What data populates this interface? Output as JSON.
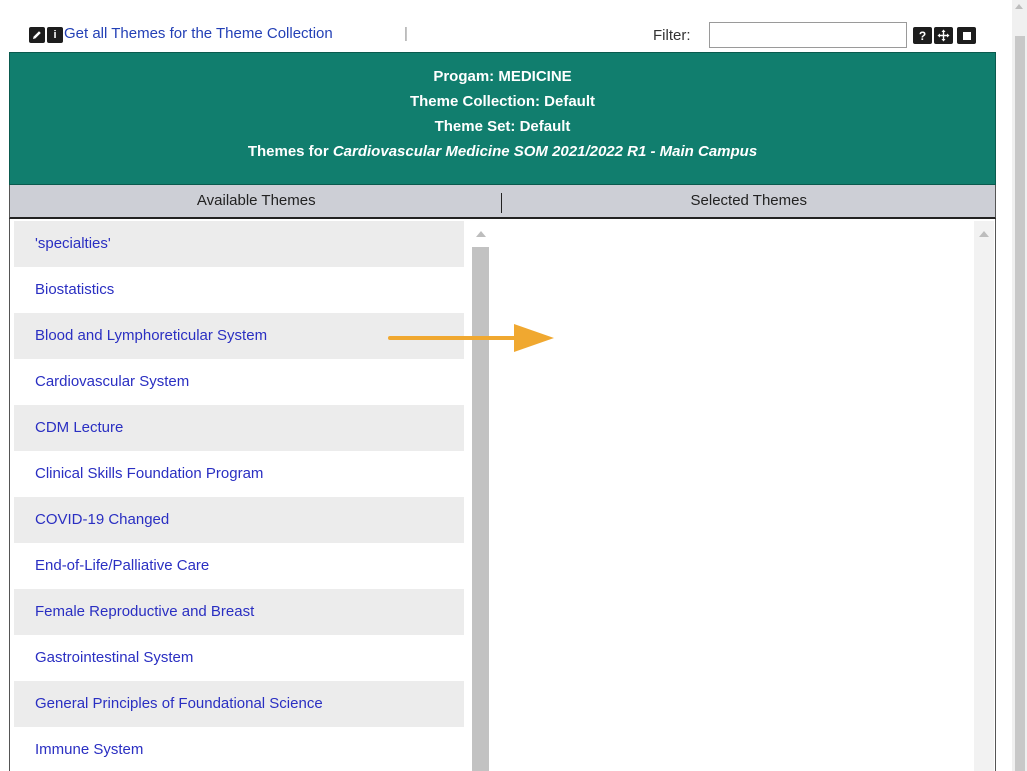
{
  "toolbar": {
    "edit_icon": "pencil-icon",
    "info_icon": "info-icon",
    "info_glyph": "i",
    "link": "Get all Themes for the Theme Collection",
    "separator": "|",
    "filter_label": "Filter:",
    "filter_value": "",
    "help_glyph": "?",
    "help_icon": "help-icon",
    "move_icon": "move-icon",
    "stop_icon": "square-icon"
  },
  "header": {
    "program": "Progam: MEDICINE",
    "collection": "Theme Collection: Default",
    "set": "Theme Set: Default",
    "themes_for_prefix": "Themes for",
    "course": "Cardiovascular Medicine SOM 2021/2022 R1 - Main Campus",
    "color": "#117e6e"
  },
  "columns": {
    "available": "Available Themes",
    "selected": "Selected Themes"
  },
  "available_themes": [
    "'specialties'",
    "Biostatistics",
    "Blood and Lymphoreticular System",
    "Cardiovascular System",
    "CDM Lecture",
    "Clinical Skills Foundation Program",
    "COVID-19 Changed",
    "End-of-Life/Palliative Care",
    "Female Reproductive and Breast",
    "Gastrointestinal System",
    "General Principles of Foundational Science",
    "Immune System"
  ],
  "selected_themes": [],
  "annotation": {
    "arrow_color": "#f0a830"
  }
}
